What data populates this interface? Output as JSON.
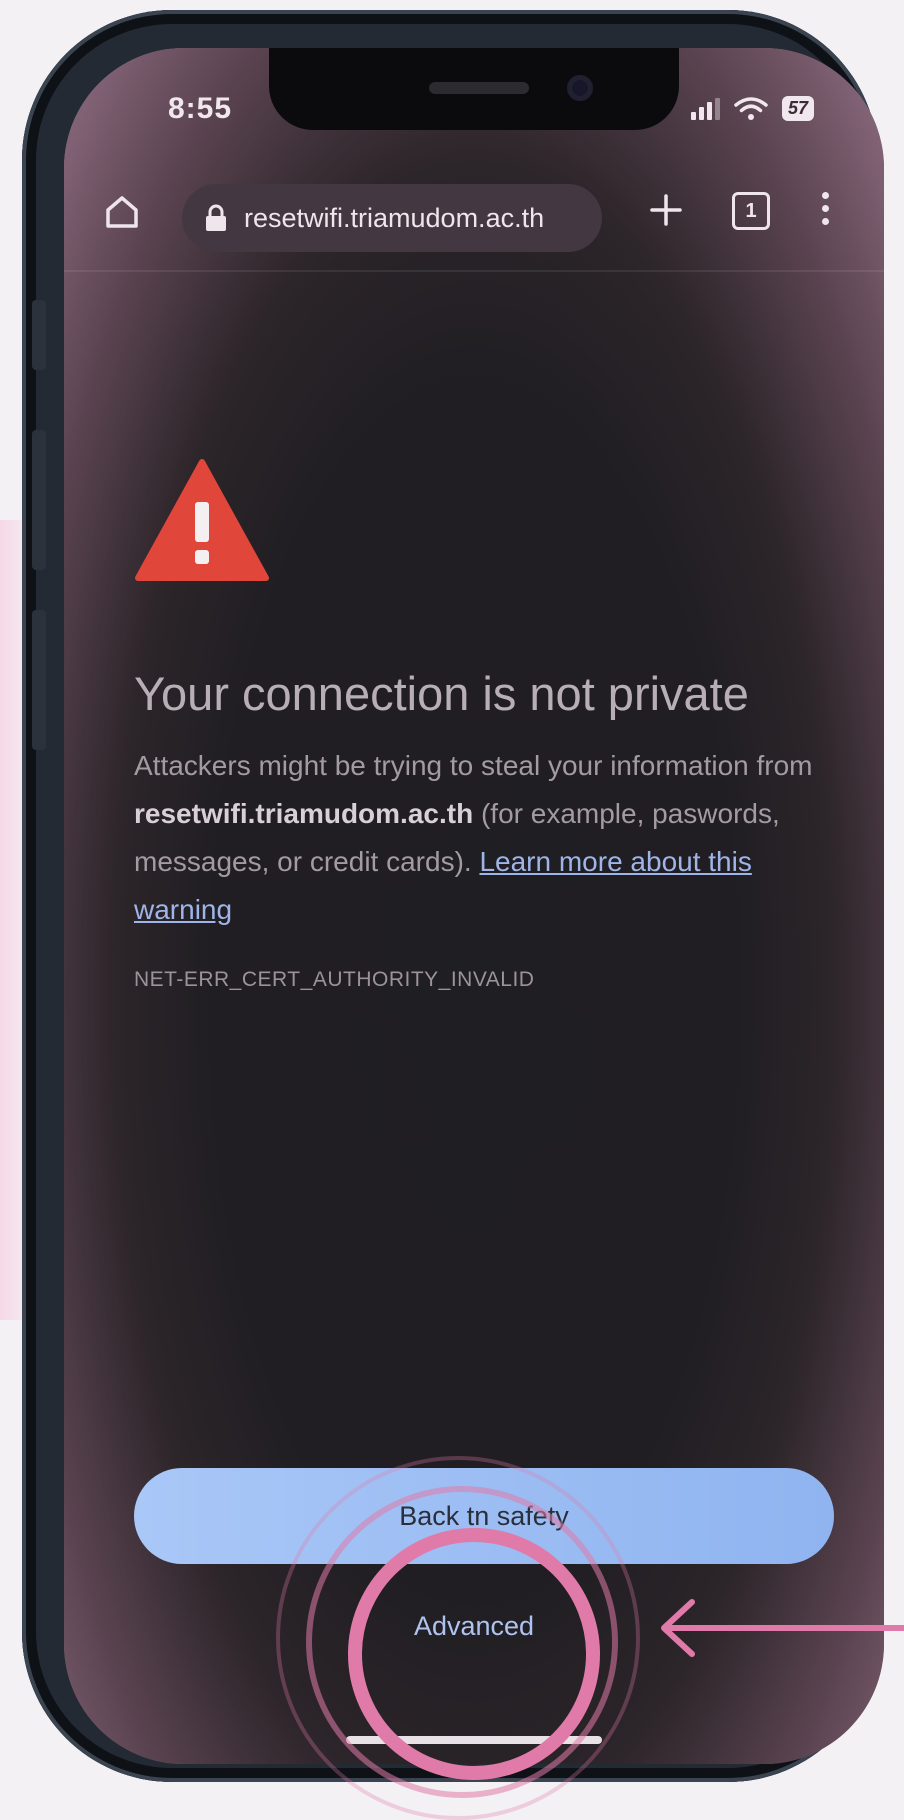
{
  "status_bar": {
    "time": "8:55",
    "battery": "57"
  },
  "browser": {
    "url": "resetwifi.triamudom.ac.th",
    "tab_count": "1"
  },
  "warning": {
    "title": "Your connection is not private",
    "body_prefix": "Attackers might be trying to steal your information from ",
    "domain": "resetwifi.triamudom.ac.th",
    "body_suffix": " (for example, paswords, messages, or credit cards). ",
    "learn_more_link": "Learn more about this warning",
    "error_code": "NET-ERR_CERT_AUTHORITY_INVALID"
  },
  "actions": {
    "back_to_safety": "Back tn safety",
    "advanced": "Advanced"
  },
  "colors": {
    "warning_red": "#e0463a",
    "primary_button": "#9fbff4",
    "link": "#9fb5e8",
    "highlight_ring": "#e07aa8"
  },
  "icons": [
    "home-icon",
    "lock-icon",
    "plus-icon",
    "tab-switcher-icon",
    "more-vert-icon",
    "warning-triangle-icon",
    "wifi-icon",
    "signal-icon",
    "battery-icon",
    "arrow-left-icon"
  ]
}
